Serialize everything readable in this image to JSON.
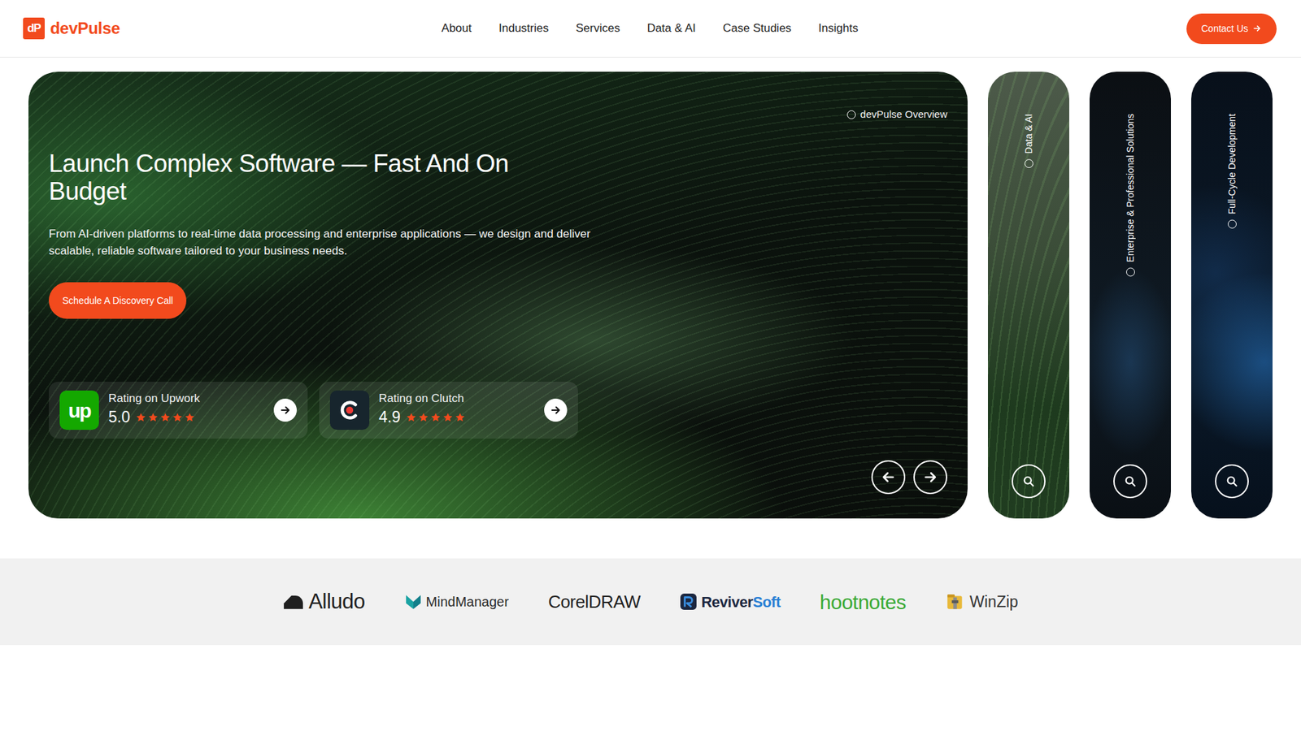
{
  "brand": {
    "mark": "dP",
    "name": "devPulse"
  },
  "nav": {
    "links": [
      {
        "label": "About"
      },
      {
        "label": "Industries"
      },
      {
        "label": "Services"
      },
      {
        "label": "Data & AI"
      },
      {
        "label": "Case Studies"
      },
      {
        "label": "Insights"
      }
    ],
    "contact": "Contact Us"
  },
  "hero": {
    "tag": "devPulse Overview",
    "title": "Launch Complex Software — Fast And On Budget",
    "description": "From AI-driven platforms to real-time data processing and enterprise applications — we design and deliver scalable, reliable software tailored to your business needs.",
    "cta": "Schedule A Discovery Call",
    "ratings": [
      {
        "kind": "upwork",
        "logo_text": "up",
        "label": "Rating on Upwork",
        "score": "5.0",
        "stars": 5
      },
      {
        "kind": "clutch",
        "label": "Rating on Clutch",
        "score": "4.9",
        "stars": 5
      }
    ]
  },
  "panels": [
    {
      "label": "Data & AI"
    },
    {
      "label": "Enterprise & Professional Solutions"
    },
    {
      "label": "Full-Cycle Development"
    }
  ],
  "clients": [
    {
      "kind": "alludo",
      "parts": [
        {
          "text": "Alludo",
          "color": "#1f1f1f"
        }
      ]
    },
    {
      "kind": "mindmanager",
      "parts": [
        {
          "text": "MindManager",
          "color": "#2b2b2b"
        }
      ]
    },
    {
      "kind": "corel",
      "parts": [
        {
          "text": "CorelDRAW",
          "color": "#1f1f1f"
        }
      ]
    },
    {
      "kind": "reviver",
      "parts": [
        {
          "text": "Reviver",
          "color": "#1c2740"
        },
        {
          "text": "Soft",
          "color": "#2a7fd4"
        }
      ]
    },
    {
      "kind": "hoot",
      "parts": [
        {
          "text": "hootnotes",
          "color": "#3aa935"
        }
      ]
    },
    {
      "kind": "winzip",
      "parts": [
        {
          "text": "WinZip",
          "color": "#333333"
        }
      ]
    }
  ]
}
